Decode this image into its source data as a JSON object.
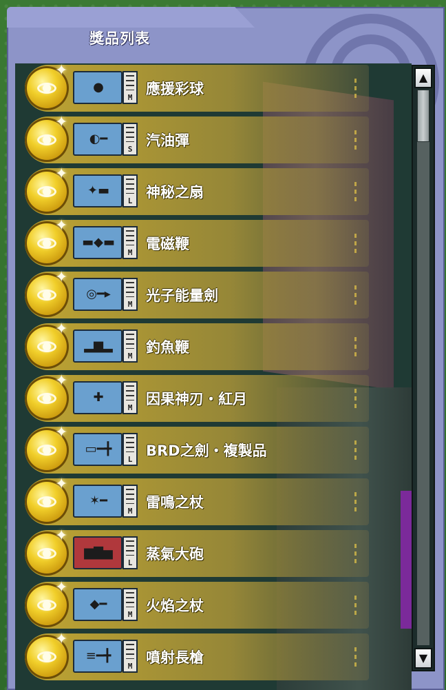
{
  "panel": {
    "title": "獎品列表"
  },
  "rewards": [
    {
      "name": "應援彩球",
      "size": "M",
      "icon": "cheer-pompom-icon",
      "glyph": "●",
      "box_color": "#6aa0cf"
    },
    {
      "name": "汽油彈",
      "size": "S",
      "icon": "molotov-bomb-icon",
      "glyph": "◐━",
      "box_color": "#6aa0cf"
    },
    {
      "name": "神秘之扇",
      "size": "L",
      "icon": "mystic-fan-icon",
      "glyph": "✦▬",
      "box_color": "#6aa0cf"
    },
    {
      "name": "電磁鞭",
      "size": "M",
      "icon": "electro-whip-icon",
      "glyph": "▬◆▬",
      "box_color": "#6aa0cf"
    },
    {
      "name": "光子能量劍",
      "size": "M",
      "icon": "photon-sword-icon",
      "glyph": "◎━▸",
      "box_color": "#6aa0cf"
    },
    {
      "name": "釣魚鞭",
      "size": "M",
      "icon": "fishing-whip-icon",
      "glyph": "▂▆▂",
      "box_color": "#6aa0cf"
    },
    {
      "name": "因果神刃・紅月",
      "size": "M",
      "icon": "karma-blade-icon",
      "glyph": "✚",
      "box_color": "#6aa0cf"
    },
    {
      "name": "BRD之劍・複製品",
      "size": "L",
      "icon": "brd-sword-replica-icon",
      "glyph": "▭━╋",
      "box_color": "#6aa0cf"
    },
    {
      "name": "雷鳴之杖",
      "size": "M",
      "icon": "thunder-staff-icon",
      "glyph": "✶━",
      "box_color": "#6aa0cf"
    },
    {
      "name": "蒸氣大砲",
      "size": "L",
      "icon": "steam-cannon-icon",
      "glyph": "▆▇▅",
      "box_color": "#b0383c"
    },
    {
      "name": "火焰之杖",
      "size": "M",
      "icon": "flame-staff-icon",
      "glyph": "◆━",
      "box_color": "#6aa0cf"
    },
    {
      "name": "噴射長槍",
      "size": "M",
      "icon": "jet-lance-icon",
      "glyph": "≡━╋",
      "box_color": "#6aa0cf"
    }
  ],
  "scrollbar": {
    "up_icon": "▲",
    "down_icon": "▼",
    "position": 0.0
  }
}
